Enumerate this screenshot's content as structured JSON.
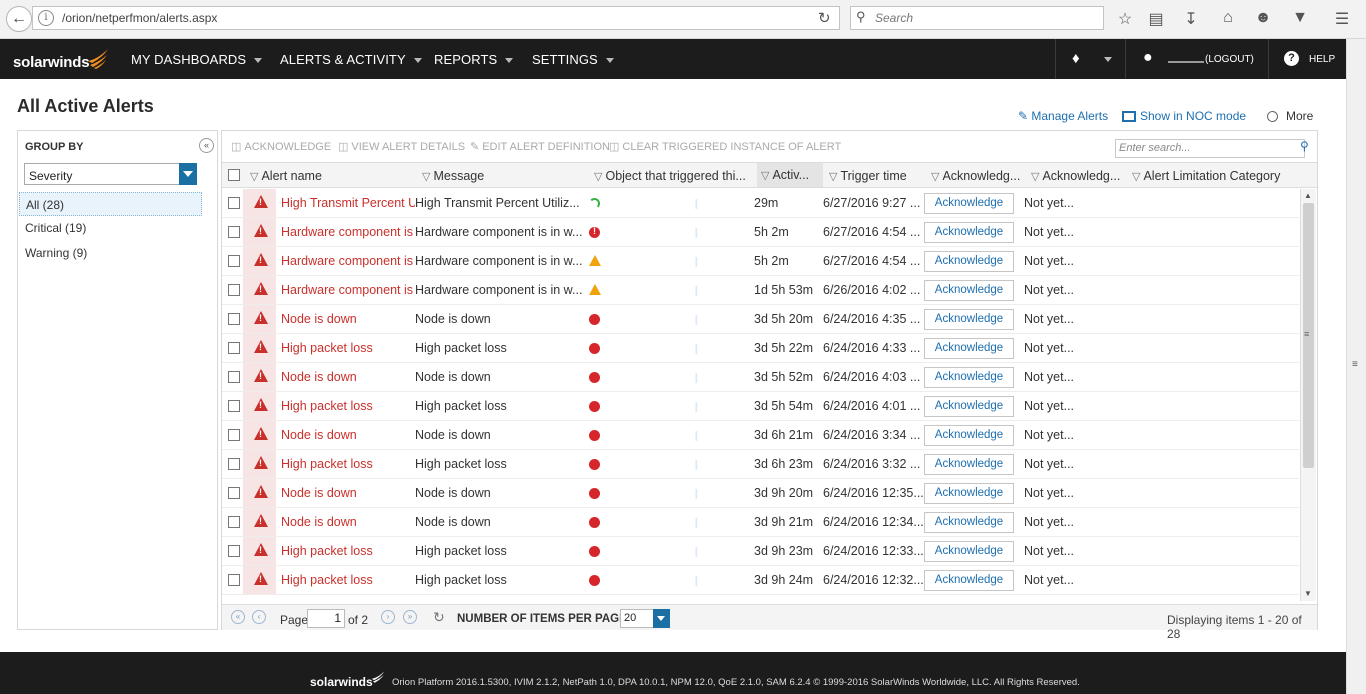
{
  "browser": {
    "url": "/orion/netperfmon/alerts.aspx",
    "search_placeholder": "Search"
  },
  "navbar": {
    "logo": "solarwinds",
    "menus": [
      "MY DASHBOARDS",
      "ALERTS & ACTIVITY",
      "REPORTS",
      "SETTINGS"
    ],
    "logout": "(LOGOUT)",
    "help": "HELP"
  },
  "page": {
    "title": "All Active Alerts",
    "manage_alerts": "Manage Alerts",
    "noc_mode": "Show in NOC mode",
    "more": "More"
  },
  "group_by": {
    "title": "GROUP BY",
    "selected": "Severity",
    "items": [
      "All (28)",
      "Critical (19)",
      "Warning (9)"
    ]
  },
  "toolbar": {
    "acknowledge": "ACKNOWLEDGE",
    "view_details": "VIEW ALERT DETAILS",
    "edit_definition": "EDIT ALERT DEFINITION",
    "clear_triggered": "CLEAR TRIGGERED INSTANCE OF ALERT",
    "search_placeholder": "Enter search..."
  },
  "columns": {
    "alert_name": "Alert name",
    "message": "Message",
    "object": "Object that triggered thi...",
    "active": "Activ...",
    "trigger_time": "Trigger time",
    "ack1": "Acknowledg...",
    "ack2": "Acknowledg...",
    "limitation": "Alert Limitation Category"
  },
  "rows": [
    {
      "name": "High Transmit Percent U",
      "message": "High Transmit Percent Utiliz...",
      "obj_status": "up",
      "active": "29m",
      "trigger": "6/27/2016 9:27 ...",
      "ack": "Acknowledge",
      "ackby": "Not yet..."
    },
    {
      "name": "Hardware component is",
      "message": "Hardware component is in w...",
      "obj_status": "crit",
      "active": "5h 2m",
      "trigger": "6/27/2016 4:54 ...",
      "ack": "Acknowledge",
      "ackby": "Not yet..."
    },
    {
      "name": "Hardware component is",
      "message": "Hardware component is in w...",
      "obj_status": "warn",
      "active": "5h 2m",
      "trigger": "6/27/2016 4:54 ...",
      "ack": "Acknowledge",
      "ackby": "Not yet..."
    },
    {
      "name": "Hardware component is",
      "message": "Hardware component is in w...",
      "obj_status": "warn",
      "active": "1d 5h 53m",
      "trigger": "6/26/2016 4:02 ...",
      "ack": "Acknowledge",
      "ackby": "Not yet..."
    },
    {
      "name": "Node is down",
      "message": "Node is down",
      "obj_status": "red",
      "active": "3d 5h 20m",
      "trigger": "6/24/2016 4:35 ...",
      "ack": "Acknowledge",
      "ackby": "Not yet..."
    },
    {
      "name": "High packet loss",
      "message": "High packet loss",
      "obj_status": "red",
      "active": "3d 5h 22m",
      "trigger": "6/24/2016 4:33 ...",
      "ack": "Acknowledge",
      "ackby": "Not yet..."
    },
    {
      "name": "Node is down",
      "message": "Node is down",
      "obj_status": "red",
      "active": "3d 5h 52m",
      "trigger": "6/24/2016 4:03 ...",
      "ack": "Acknowledge",
      "ackby": "Not yet..."
    },
    {
      "name": "High packet loss",
      "message": "High packet loss",
      "obj_status": "red",
      "active": "3d 5h 54m",
      "trigger": "6/24/2016 4:01 ...",
      "ack": "Acknowledge",
      "ackby": "Not yet..."
    },
    {
      "name": "Node is down",
      "message": "Node is down",
      "obj_status": "red",
      "active": "3d 6h 21m",
      "trigger": "6/24/2016 3:34 ...",
      "ack": "Acknowledge",
      "ackby": "Not yet..."
    },
    {
      "name": "High packet loss",
      "message": "High packet loss",
      "obj_status": "red",
      "active": "3d 6h 23m",
      "trigger": "6/24/2016 3:32 ...",
      "ack": "Acknowledge",
      "ackby": "Not yet..."
    },
    {
      "name": "Node is down",
      "message": "Node is down",
      "obj_status": "red",
      "active": "3d 9h 20m",
      "trigger": "6/24/2016 12:35...",
      "ack": "Acknowledge",
      "ackby": "Not yet..."
    },
    {
      "name": "Node is down",
      "message": "Node is down",
      "obj_status": "red",
      "active": "3d 9h 21m",
      "trigger": "6/24/2016 12:34...",
      "ack": "Acknowledge",
      "ackby": "Not yet..."
    },
    {
      "name": "High packet loss",
      "message": "High packet loss",
      "obj_status": "red",
      "active": "3d 9h 23m",
      "trigger": "6/24/2016 12:33...",
      "ack": "Acknowledge",
      "ackby": "Not yet..."
    },
    {
      "name": "High packet loss",
      "message": "High packet loss",
      "obj_status": "red",
      "active": "3d 9h 24m",
      "trigger": "6/24/2016 12:32...",
      "ack": "Acknowledge",
      "ackby": "Not yet..."
    }
  ],
  "pager": {
    "page_label": "Page",
    "page_value": "1",
    "of_label": "of 2",
    "per_page_label": "NUMBER OF ITEMS PER PAGE:",
    "per_page_value": "20",
    "display": "Displaying items 1 - 20 of 28"
  },
  "footer": {
    "logo": "solarwinds",
    "text": "Orion Platform 2016.1.5300, IVIM 2.1.2, NetPath 1.0, DPA 10.0.1, NPM 12.0, QoE 2.1.0, SAM 6.2.4 © 1999-2016 SolarWinds Worldwide, LLC. All Rights Reserved."
  },
  "colors": {
    "nav_bg": "#1c1c1c",
    "link": "#1e6fb0",
    "critical": "#c9302c",
    "warning": "#f0a30a",
    "brand_flame": "#f28e1c"
  }
}
